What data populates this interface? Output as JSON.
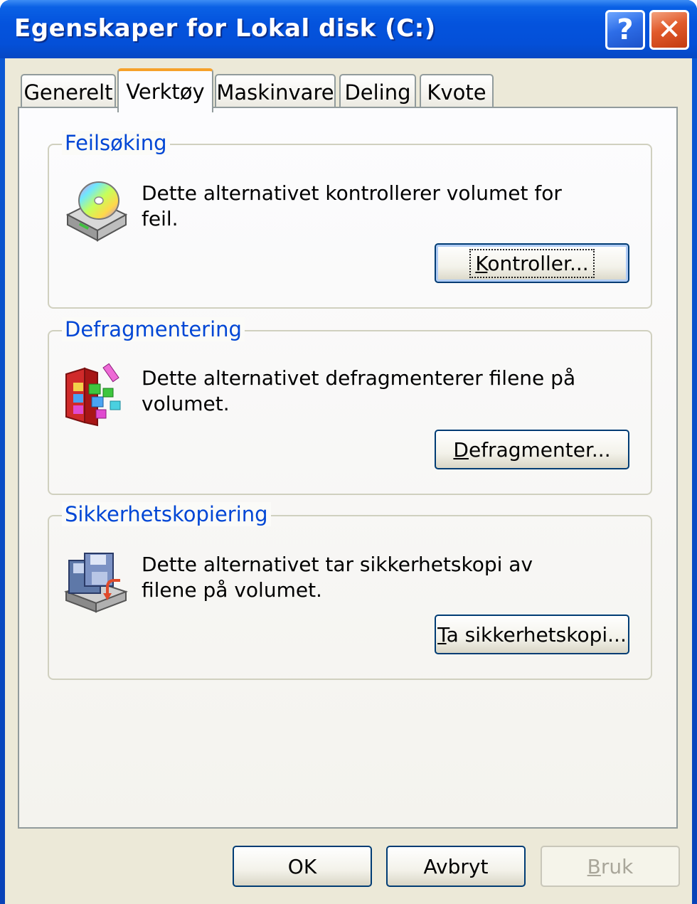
{
  "window": {
    "title": "Egenskaper for Lokal disk (C:)",
    "help_glyph": "?",
    "close_glyph": "✕"
  },
  "tabs": [
    {
      "label": "Generelt",
      "active": false
    },
    {
      "label": "Verktøy",
      "active": true
    },
    {
      "label": "Maskinvare",
      "active": false
    },
    {
      "label": "Deling",
      "active": false
    },
    {
      "label": "Kvote",
      "active": false
    }
  ],
  "groups": {
    "error_check": {
      "title": "Feilsøking",
      "description": "Dette alternativet kontrollerer volumet for feil.",
      "button_mnemonic": "K",
      "button_rest": "ontroller...",
      "icon": "disk-check-icon"
    },
    "defrag": {
      "title": "Defragmentering",
      "description": "Dette alternativet defragmenterer filene på volumet.",
      "button_mnemonic": "D",
      "button_rest": "efragmenter...",
      "icon": "defrag-icon"
    },
    "backup": {
      "title": "Sikkerhetskopiering",
      "description": "Dette alternativet tar sikkerhetskopi av filene på volumet.",
      "button_mnemonic": "T",
      "button_rest": "a sikkerhetskopi...",
      "icon": "backup-icon"
    }
  },
  "footer": {
    "ok": "OK",
    "cancel": "Avbryt",
    "apply_mnemonic": "B",
    "apply_rest": "ruk"
  },
  "colors": {
    "titlebar": "#0453dd",
    "group_title": "#0046d5",
    "active_tab_accent": "#f6a12a",
    "button_border": "#003c74"
  }
}
